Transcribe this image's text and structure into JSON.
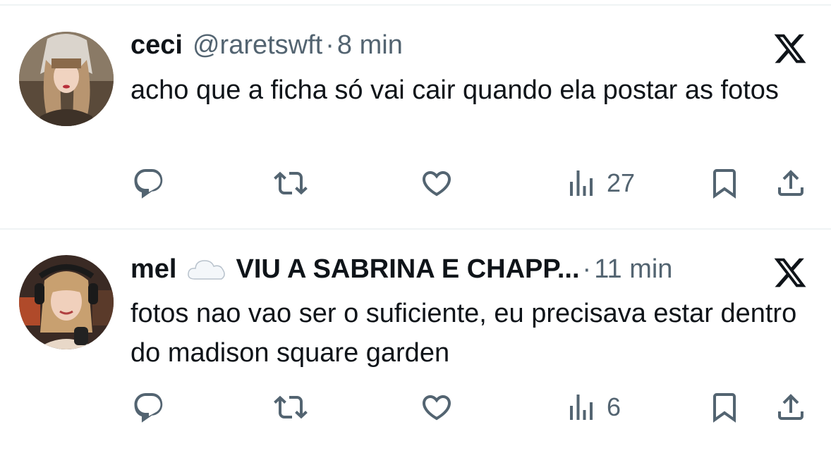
{
  "tweets": [
    {
      "name": "ceci",
      "handle": "@raretswft",
      "separator": "·",
      "time": "8 min",
      "text": "acho que a ficha só vai cair quando ela postar as fotos",
      "views": "27"
    },
    {
      "name": "mel",
      "name_emoji": "cloud-emoji",
      "name_suffix": "VIU A SABRINA E CHAPP...",
      "separator": "·",
      "time": "11 min",
      "text": "fotos nao vao ser o suficiente, eu precisava estar dentro do madison square garden",
      "views": "6"
    }
  ],
  "icons": {
    "reply": "reply-icon",
    "retweet": "retweet-icon",
    "like": "like-icon",
    "views": "views-icon",
    "bookmark": "bookmark-icon",
    "share": "share-icon",
    "brand": "x-logo"
  },
  "colors": {
    "text": "#0f1419",
    "secondary": "#536471",
    "divider": "#eff3f4",
    "background": "#ffffff"
  }
}
